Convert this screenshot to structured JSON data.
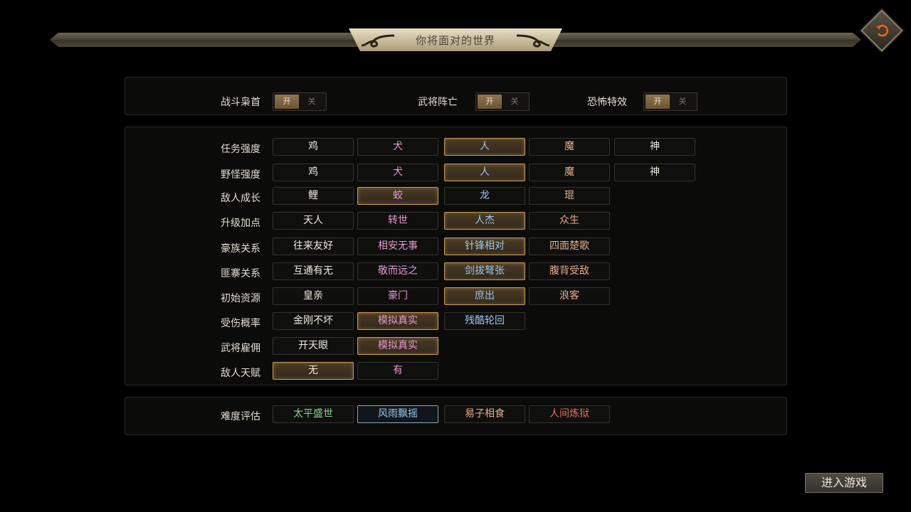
{
  "header": {
    "title": "你将面对的世界",
    "back_icon": "back-arrow-icon"
  },
  "toggles": [
    {
      "label": "战斗枭首",
      "on": "开",
      "off": "关"
    },
    {
      "label": "武将阵亡",
      "on": "开",
      "off": "关"
    },
    {
      "label": "恐怖特效",
      "on": "开",
      "off": "关"
    }
  ],
  "settings": [
    {
      "label": "任务强度",
      "options": [
        "鸡",
        "犬",
        "人",
        "魔",
        "神"
      ],
      "selected": 2
    },
    {
      "label": "野怪强度",
      "options": [
        "鸡",
        "犬",
        "人",
        "魔",
        "神"
      ],
      "selected": 2
    },
    {
      "label": "敌人成长",
      "options": [
        "鲤",
        "蛟",
        "龙",
        "琨"
      ],
      "selected": 1
    },
    {
      "label": "升级加点",
      "options": [
        "天人",
        "转世",
        "人杰",
        "众生"
      ],
      "selected": 2
    },
    {
      "label": "豪族关系",
      "options": [
        "往来友好",
        "相安无事",
        "针锋相对",
        "四面楚歌"
      ],
      "selected": 2
    },
    {
      "label": "匪寨关系",
      "options": [
        "互通有无",
        "敬而远之",
        "剑拔弩张",
        "腹背受敌"
      ],
      "selected": 2
    },
    {
      "label": "初始资源",
      "options": [
        "皇亲",
        "豪门",
        "庶出",
        "浪客"
      ],
      "selected": 2
    },
    {
      "label": "受伤概率",
      "options": [
        "金刚不坏",
        "模拟真实",
        "残酷轮回"
      ],
      "selected": 1
    },
    {
      "label": "武将雇佣",
      "options": [
        "开天眼",
        "模拟真实"
      ],
      "selected": 1
    },
    {
      "label": "敌人天赋",
      "options": [
        "无",
        "有"
      ],
      "selected": 0
    }
  ],
  "rating": {
    "label": "难度评估",
    "options": [
      "太平盛世",
      "风雨飘摇",
      "易子相食",
      "人间炼狱"
    ],
    "selected": 1
  },
  "enter_button": "进入游戏",
  "colors": {
    "col1": "#f0ebe0",
    "col2": "#e59ad0",
    "col3": "#9cc8ee",
    "col4": "#e6ae8c",
    "col5": "#f0ebe0",
    "rating": [
      "#8fd08c",
      "#9cc8ee",
      "#e6ae8c",
      "#e07562"
    ]
  }
}
